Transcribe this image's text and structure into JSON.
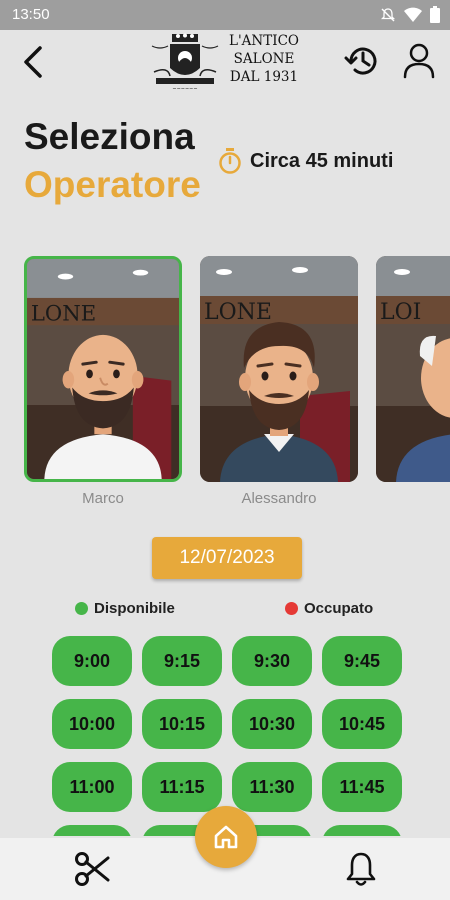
{
  "status_bar": {
    "time": "13:50",
    "icons": [
      "mute-icon",
      "wifi-icon",
      "battery-icon"
    ]
  },
  "header": {
    "back_icon": "arrow-left-icon",
    "logo_lines": [
      "L'ANTICO",
      "SALONE",
      "DAL 1931"
    ],
    "history_icon": "history-icon",
    "profile_icon": "person-icon"
  },
  "title": {
    "line1": "Seleziona",
    "line2": "Operatore"
  },
  "duration": {
    "icon": "timer-icon",
    "text": "Circa 45 minuti"
  },
  "operators": [
    {
      "name": "Marco",
      "selected": true
    },
    {
      "name": "Alessandro",
      "selected": false
    },
    {
      "name": "",
      "selected": false
    }
  ],
  "date": "12/07/2023",
  "legend": {
    "available": {
      "label": "Disponibile",
      "color": "#46b549"
    },
    "busy": {
      "label": "Occupato",
      "color": "#e53935"
    }
  },
  "time_slots": [
    "9:00",
    "9:15",
    "9:30",
    "9:45",
    "10:00",
    "10:15",
    "10:30",
    "10:45",
    "11:00",
    "11:15",
    "11:30",
    "11:45",
    "",
    "",
    "",
    ""
  ],
  "bottom_nav": {
    "left_icon": "scissors-icon",
    "center_icon": "home-icon",
    "right_icon": "bell-icon"
  },
  "colors": {
    "accent": "#e7a93b",
    "available": "#46b549",
    "background": "#e4e4e4"
  }
}
